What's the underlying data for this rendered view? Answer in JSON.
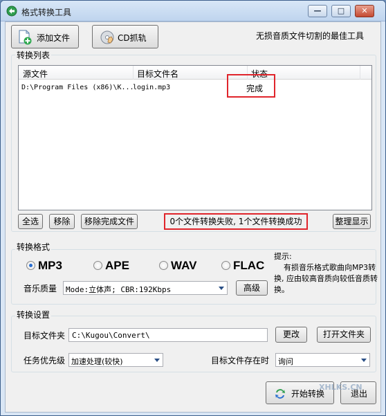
{
  "window": {
    "title": "格式转换工具",
    "minimize_glyph": "—",
    "maximize_glyph": "□",
    "close_glyph": "✕"
  },
  "toolbar": {
    "add_file_label": "添加文件",
    "cd_rip_label": "CD抓轨",
    "tagline": "无损音质文件切割的最佳工具"
  },
  "conversion_list": {
    "group_title": "转换列表",
    "columns": [
      "源文件",
      "目标文件名",
      "状态"
    ],
    "rows": [
      {
        "source": "D:\\Program Files (x86)\\K...",
        "target": "login.mp3",
        "status": "完成"
      }
    ]
  },
  "list_actions": {
    "select_all": "全选",
    "remove": "移除",
    "remove_done": "移除完成文件",
    "status_message": "0个文件转换失败, 1个文件转换成功",
    "arrange": "整理显示"
  },
  "format": {
    "group_title": "转换格式",
    "options": [
      {
        "label": "MP3",
        "selected": true
      },
      {
        "label": "APE",
        "selected": false
      },
      {
        "label": "WAV",
        "selected": false
      },
      {
        "label": "FLAC",
        "selected": false
      }
    ],
    "hint": "提示:\n    有损音乐格式歌曲向MP3转换, 应由较高音质向较低音质转换。",
    "quality_label": "音乐质量",
    "quality_value": "Mode:立体声; CBR:192Kbps",
    "advanced_label": "高级"
  },
  "settings": {
    "group_title": "转换设置",
    "target_folder_label": "目标文件夹",
    "target_folder_value": "C:\\Kugou\\Convert\\",
    "change_label": "更改",
    "open_folder_label": "打开文件夹",
    "priority_label": "任务优先级",
    "priority_value": "加速处理(较快)",
    "exists_label": "目标文件存在时",
    "exists_value": "询问"
  },
  "footer": {
    "start_label": "开始转换",
    "exit_label": "退出",
    "watermark": "XHLKS.CN"
  },
  "colors": {
    "highlight_red": "#e0242b",
    "radio_accent": "#2a6fd1"
  }
}
